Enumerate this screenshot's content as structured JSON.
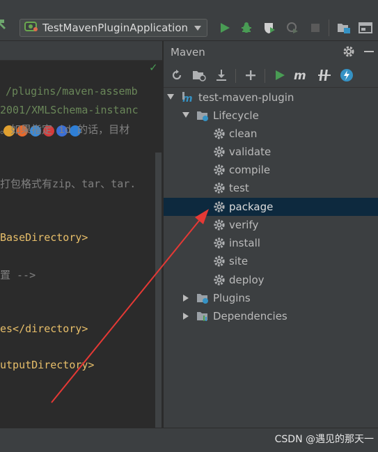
{
  "toolbar": {
    "run_config_label": "TestMavenPluginApplication",
    "icons": [
      "hammer-icon",
      "spring-boot-icon",
      "run-icon",
      "debug-icon",
      "coverage-icon",
      "profile-icon",
      "stop-icon",
      "project-structure-icon",
      "terminal-icon"
    ]
  },
  "editor": {
    "lines": [
      {
        "text": "/plugins/maven-assemb",
        "kind": "str"
      },
      {
        "text": "2001/XMLSchema-instanc",
        "kind": "str"
      },
      {
        "text": "。如果指定 id 的话，目材",
        "kind": "com"
      },
      {
        "text": "打包格式有zip、tar、tar.",
        "kind": "com"
      },
      {
        "text": "BaseDirectory>",
        "kind": "tag"
      },
      {
        "text": "置      -->",
        "kind": "com"
      },
      {
        "text": "es</directory>",
        "kind": "tag"
      },
      {
        "text": "utputDirectory>",
        "kind": "tag"
      }
    ]
  },
  "maven": {
    "title": "Maven",
    "toolbar_icons": [
      "reload-icon",
      "add-project-icon",
      "download-icon",
      "plus-icon",
      "run-maven-icon",
      "execute-goal-icon",
      "skip-tests-icon",
      "lightning-icon"
    ],
    "root": "test-maven-plugin",
    "lifecycle_label": "Lifecycle",
    "lifecycle": [
      "clean",
      "validate",
      "compile",
      "test",
      "package",
      "verify",
      "install",
      "site",
      "deploy"
    ],
    "selected": "package",
    "plugins_label": "Plugins",
    "dependencies_label": "Dependencies"
  },
  "watermark": "CSDN @遇见的那天一",
  "colors": {
    "panel_bg": "#3c3f41",
    "editor_bg": "#2b2b2b",
    "selection": "#0d293e",
    "run_green": "#499c54",
    "annotation_red": "#e53935"
  }
}
